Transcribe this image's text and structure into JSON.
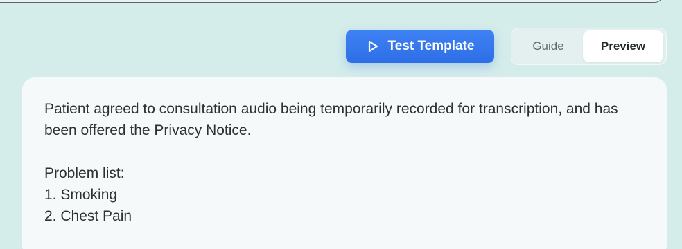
{
  "toolbar": {
    "test_button_label": "Test Template",
    "test_button_icon": "play-icon",
    "toggle": {
      "options": [
        "Guide",
        "Preview"
      ],
      "selected": "Preview"
    }
  },
  "preview": {
    "consent_text": "Patient agreed to consultation audio being temporarily recorded for transcription, and has been offered the Privacy Notice.",
    "problem_list_heading": "Problem list:",
    "problems": [
      "1. Smoking",
      "2. Chest Pain"
    ]
  },
  "colors": {
    "background": "#d4ecea",
    "accent": "#3579ee",
    "card": "#f5f9f9"
  }
}
